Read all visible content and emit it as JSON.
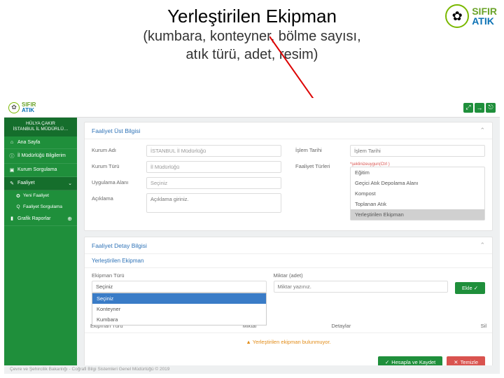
{
  "slide": {
    "title": "Yerleştirilen Ekipman",
    "sub1": "(kumbara, konteyner, bölme sayısı,",
    "sub2": "atık türü, adet, resim)"
  },
  "logo": {
    "line1": "SIFIR",
    "line2": "ATIK"
  },
  "topbar": {
    "btn1": "⤢",
    "btn2": "→",
    "btn3": "⎋"
  },
  "sidebar": {
    "user1": "HÜLYA ÇAKIR",
    "user2": "İSTANBUL İL MÜDÜRLÜ…",
    "items": [
      {
        "ic": "⌂",
        "label": "Ana Sayfa"
      },
      {
        "ic": "ⓘ",
        "label": "İl Müdürlüğü Bilgilerim"
      },
      {
        "ic": "▣",
        "label": "Kurum Sorgulama"
      },
      {
        "ic": "✎",
        "label": "Faaliyet"
      }
    ],
    "subs": [
      {
        "ic": "✪",
        "label": "Yeni Faaliyet"
      },
      {
        "ic": "Q",
        "label": "Faaliyet Sorgulama"
      }
    ],
    "last": {
      "ic": "▮",
      "label": "Grafik Raporlar"
    }
  },
  "panel1": {
    "title": "Faaliyet Üst Bilgisi",
    "kurumAdi": {
      "lab": "Kurum Adı",
      "val": "İSTANBUL İl Müdürlüğü"
    },
    "kurumTuru": {
      "lab": "Kurum Türü",
      "val": "İl Müdürlüğü"
    },
    "uygAlani": {
      "lab": "Uygulama Alanı",
      "val": "Seçiniz"
    },
    "aciklama": {
      "lab": "Açıklama",
      "ph": "Açıklama giriniz."
    },
    "islemTarihi": {
      "lab": "İşlem Tarihi",
      "ph": "İşlem Tarihi"
    },
    "faaliyetTurleri": {
      "lab": "Faaliyet Türleri",
      "req": "*şeklinizeuygun(Ctrl )",
      "opts": [
        "Eğitim",
        "Geçici Atık Depolama Alanı",
        "Kompost",
        "Toplanan Atık",
        "Yerleştirilen Ekipman"
      ]
    }
  },
  "panel2": {
    "title": "Faaliyet Detay Bilgisi",
    "section": "Yerleştirilen Ekipman",
    "ekipTuru": {
      "lab": "Ekipman Türü",
      "sel": "Seçiniz",
      "opts": [
        "Seçiniz",
        "Konteyner",
        "Kumbara"
      ]
    },
    "miktar": {
      "lab": "Miktar (adet)",
      "ph": "Miktar yazınız."
    },
    "ekle": "Ekle  ✓",
    "cols": [
      "Ekipman Türü",
      "Miktar",
      "Detaylar",
      "Sil"
    ],
    "empty": "Yerleştirilen ekipman bulunmuyor.",
    "save": "Hesapla ve Kaydet",
    "clear": "Temizle"
  },
  "footer": "Çevre ve Şehircilik Bakanlığı - Coğrafi Bilgi Sistemleri Genel Müdürlüğü © 2019"
}
